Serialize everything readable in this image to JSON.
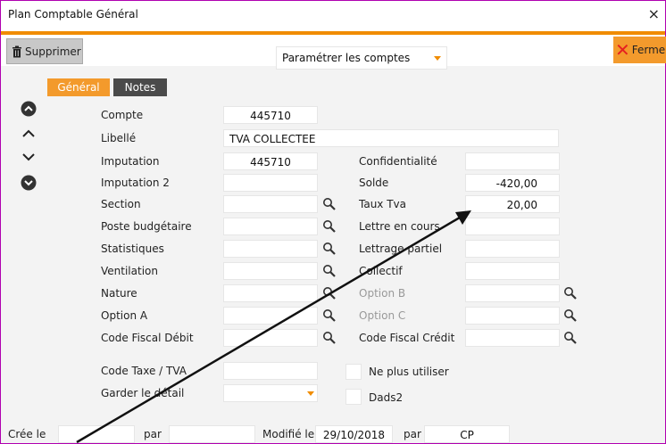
{
  "window": {
    "title": "Plan Comptable Général",
    "close_icon": "×"
  },
  "toolbar": {
    "delete_label": "Supprimer",
    "close_label": "Fermer",
    "dropdown_value": "Paramétrer les comptes"
  },
  "tabs": {
    "general": "Général",
    "notes": "Notes"
  },
  "form": {
    "compte": {
      "label": "Compte",
      "value": "445710"
    },
    "libelle": {
      "label": "Libellé",
      "value": "TVA COLLECTEE"
    },
    "imputation": {
      "label": "Imputation",
      "value": "445710"
    },
    "imputation2": {
      "label": "Imputation 2",
      "value": ""
    },
    "section": {
      "label": "Section",
      "value": ""
    },
    "poste": {
      "label": "Poste budgétaire",
      "value": ""
    },
    "statistiques": {
      "label": "Statistiques",
      "value": ""
    },
    "ventilation": {
      "label": "Ventilation",
      "value": ""
    },
    "nature": {
      "label": "Nature",
      "value": ""
    },
    "optionA": {
      "label": "Option A",
      "value": ""
    },
    "codeFiscalDebit": {
      "label": "Code Fiscal Débit",
      "value": ""
    },
    "confidentialite": {
      "label": "Confidentialité",
      "value": ""
    },
    "solde": {
      "label": "Solde",
      "value": "-420,00"
    },
    "tauxTva": {
      "label": "Taux Tva",
      "value": "20,00"
    },
    "lettreEnCours": {
      "label": "Lettre en cours",
      "value": ""
    },
    "lettragePartiel": {
      "label": "Lettrage partiel",
      "value": ""
    },
    "collectif": {
      "label": "Collectif",
      "value": ""
    },
    "optionB": {
      "label": "Option B",
      "value": ""
    },
    "optionC": {
      "label": "Option C",
      "value": ""
    },
    "codeFiscalCredit": {
      "label": "Code Fiscal Crédit",
      "value": ""
    },
    "codeTaxe": {
      "label": "Code Taxe / TVA",
      "value": ""
    },
    "garderDetail": {
      "label": "Garder le détail",
      "value": ""
    },
    "nePlusUtiliser": {
      "label": "Ne plus utiliser"
    },
    "dads2": {
      "label": "Dads2"
    }
  },
  "footer": {
    "cree_le_label": "Crée le",
    "cree_le_value": "",
    "par_label": "par",
    "par_value": "",
    "modifie_le_label": "Modifié le",
    "modifie_le_value": "29/10/2018",
    "par2_label": "par",
    "par2_value": "CP"
  },
  "colors": {
    "accent": "#f08c00",
    "tab_inactive": "#4a4a4a",
    "border": "#b000b0"
  }
}
